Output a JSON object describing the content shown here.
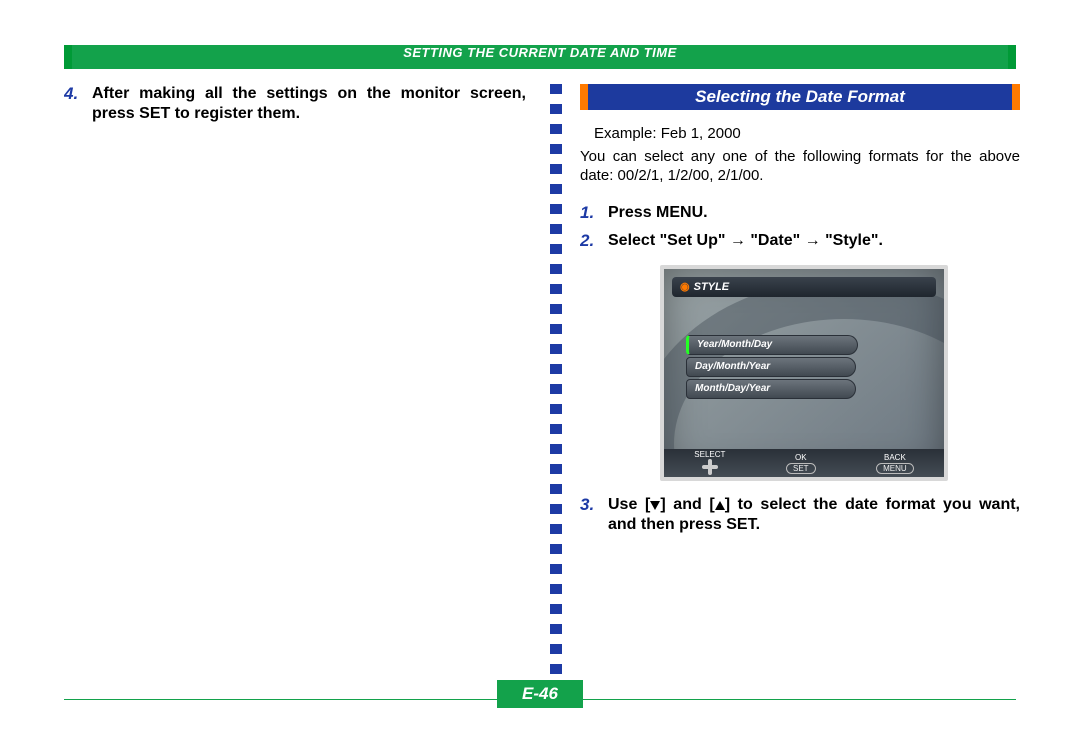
{
  "header": {
    "title": "SETTING THE CURRENT DATE AND TIME"
  },
  "left": {
    "step4_num": "4.",
    "step4_text": "After making all the settings on the monitor screen, press SET to register them."
  },
  "right": {
    "subheading": "Selecting the Date Format",
    "example": "Example:  Feb 1, 2000",
    "intro": "You can select any one of the following formats for the above date: 00/2/1, 1/2/00, 2/1/00.",
    "step1_num": "1.",
    "step1_text": "Press MENU.",
    "step2_num": "2.",
    "step2_prefix": "Select \"Set Up\" ",
    "step2_mid1": " \"Date\" ",
    "step2_suffix": " \"Style\".",
    "lcd": {
      "title": "STYLE",
      "options": [
        "Year/Month/Day",
        "Day/Month/Year",
        "Month/Day/Year"
      ],
      "foot": {
        "select_label": "SELECT",
        "ok_label": "OK",
        "ok_btn": "SET",
        "back_label": "BACK",
        "back_btn": "MENU"
      }
    },
    "step3_num": "3.",
    "step3_a": "Use [",
    "step3_b": "] and [",
    "step3_c": "] to select the date format you want, and then press SET."
  },
  "page_number": "E-46"
}
